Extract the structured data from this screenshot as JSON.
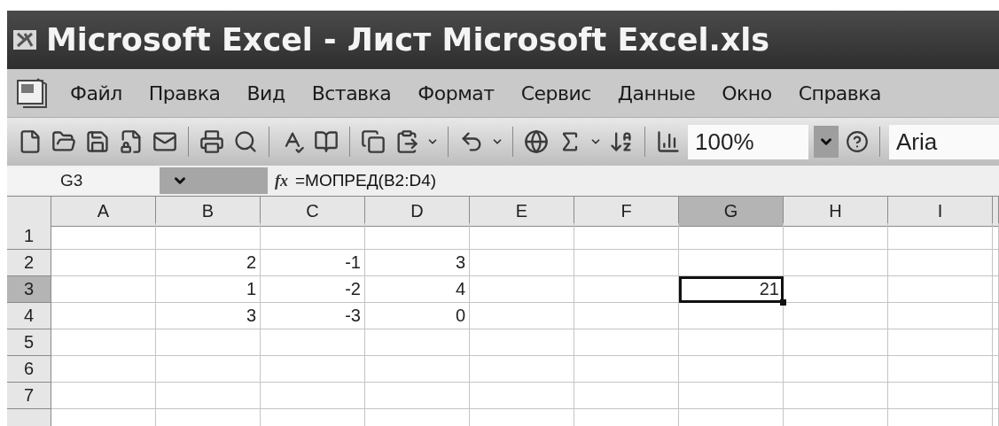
{
  "window": {
    "title": "Microsoft Excel - Лист Microsoft Excel.xls"
  },
  "menu": [
    {
      "label": "Файл"
    },
    {
      "label": "Правка"
    },
    {
      "label": "Вид"
    },
    {
      "label": "Вставка"
    },
    {
      "label": "Формат"
    },
    {
      "label": "Сервис"
    },
    {
      "label": "Данные"
    },
    {
      "label": "Окно"
    },
    {
      "label": "Справка"
    }
  ],
  "toolbar": {
    "zoom": "100%",
    "font": "Aria"
  },
  "formula_bar": {
    "name_box": "G3",
    "fx_label": "fx",
    "formula": "=МОПРЕД(B2:D4)"
  },
  "sheet": {
    "columns": [
      {
        "label": "A",
        "selected": false
      },
      {
        "label": "B",
        "selected": false
      },
      {
        "label": "C",
        "selected": false
      },
      {
        "label": "D",
        "selected": false
      },
      {
        "label": "E",
        "selected": false
      },
      {
        "label": "F",
        "selected": false
      },
      {
        "label": "G",
        "selected": true
      },
      {
        "label": "H",
        "selected": false
      },
      {
        "label": "I",
        "selected": false
      }
    ],
    "rows": [
      {
        "label": "1",
        "selected": false,
        "cells": []
      },
      {
        "label": "2",
        "selected": false,
        "cells": [
          null,
          "2",
          "-1",
          "3"
        ]
      },
      {
        "label": "3",
        "selected": true,
        "cells": [
          null,
          "1",
          "-2",
          "4",
          null,
          null,
          "21"
        ]
      },
      {
        "label": "4",
        "selected": false,
        "cells": [
          null,
          "3",
          "-3",
          "0"
        ]
      },
      {
        "label": "5",
        "selected": false,
        "cells": []
      },
      {
        "label": "6",
        "selected": false,
        "cells": []
      },
      {
        "label": "7",
        "selected": false,
        "cells": []
      }
    ]
  }
}
